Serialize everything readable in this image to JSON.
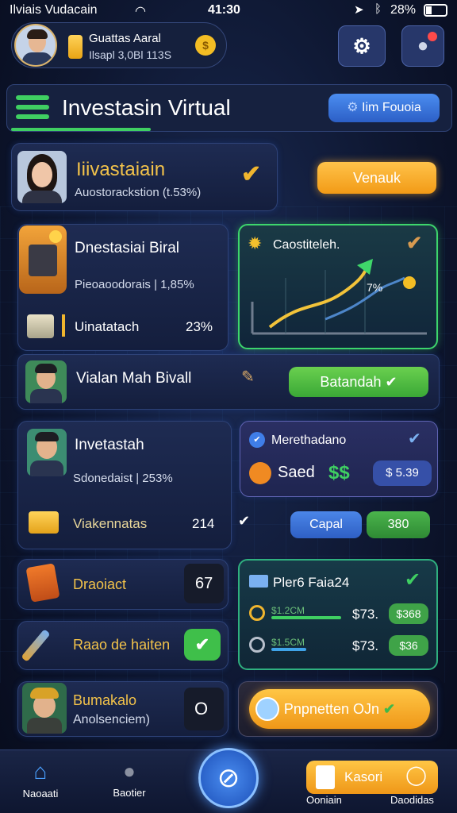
{
  "status_bar": {
    "carrier": "Ilviais Vudacain",
    "time": "41:30",
    "battery": "28%"
  },
  "profile": {
    "name": "Guattas Aaral",
    "balance": "Ilsapl 3,0Bl 113S"
  },
  "header": {
    "title": "Investasin Virtual",
    "action": "Iim Fouoia"
  },
  "hero": {
    "title": "Iiivastaiain",
    "subtitle": "Auostorackstion (t.53%)",
    "action": "Venauk"
  },
  "card_a": {
    "title": "Dnestasiai Biral",
    "subtitle": "Pieoaoodorais | 1,85%",
    "row_label": "Uinatatach",
    "row_value": "23%"
  },
  "growth": {
    "title": "Caostiteleh.",
    "value": "7%"
  },
  "row_b": {
    "name": "Vialan Mah Bivall",
    "action": "Batandah"
  },
  "card_c": {
    "title": "Invetastah",
    "subtitle": "Sdonedaist | 253%",
    "row_label": "Viakennatas",
    "row_value": "214"
  },
  "card_d": {
    "title": "Merethadano",
    "label": "Saed",
    "currency": "$$",
    "amount": "$ 5.39",
    "btn1": "Capal",
    "btn2": "380"
  },
  "card_e": {
    "label": "Draoiact",
    "value": "67"
  },
  "card_f": {
    "label": "Raao de haiten"
  },
  "card_g": {
    "title": "Pler6 Faia24",
    "r1_label": "$1.2CM",
    "r1_value": "$73.",
    "r1_badge": "$368",
    "r2_label": "$1.5CM",
    "r2_value": "$73.",
    "r2_badge": "$36"
  },
  "card_h": {
    "title": "Bumakalo",
    "subtitle": "Anolsenciem)",
    "value": "O"
  },
  "card_i": {
    "action": "Pnpnetten OJn"
  },
  "nav": {
    "home": "Naoaati",
    "profile": "Baotier",
    "center": "",
    "note": "Kasori",
    "left_label": "Ooniain",
    "right_label": "Daodidas"
  },
  "colors": {
    "accent_green": "#4fd86a",
    "accent_orange": "#f6a72c",
    "accent_blue": "#3f7ee8",
    "gold": "#f0b52e"
  }
}
